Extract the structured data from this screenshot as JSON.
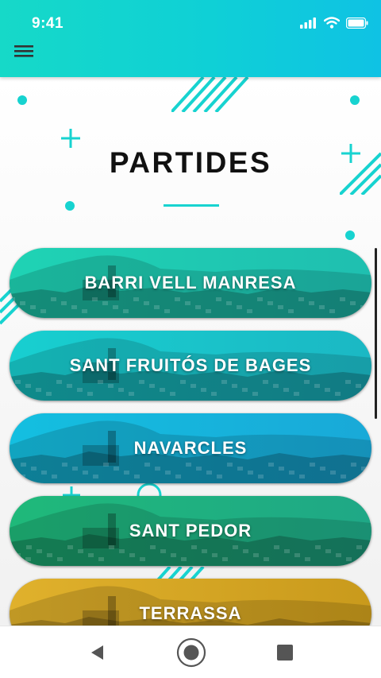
{
  "status_bar": {
    "time": "9:41",
    "icons": [
      "signal-icon",
      "wifi-icon",
      "battery-icon"
    ]
  },
  "toolbar": {
    "menu_icon": "hamburger-menu-icon"
  },
  "page": {
    "title": "PARTIDES"
  },
  "cities": [
    {
      "label": "BARRI VELL MANRESA",
      "color_left": "#1fd3b4",
      "color_right": "#1fbfb0"
    },
    {
      "label": "SANT FRUITÓS DE BAGES",
      "color_left": "#18cfd0",
      "color_right": "#1bb8c4"
    },
    {
      "label": "NAVARCLES",
      "color_left": "#14bfe0",
      "color_right": "#19a9d8"
    },
    {
      "label": "SANT PEDOR",
      "color_left": "#1fb97a",
      "color_right": "#1fa886"
    },
    {
      "label": "TERRASSA",
      "color_left": "#e0b12c",
      "color_right": "#c99a1c"
    }
  ],
  "nav": {
    "back": "back-icon",
    "home": "home-icon",
    "recents": "recents-icon"
  },
  "colors": {
    "accent": "#17d3d0",
    "header_start": "#16d9c8",
    "header_end": "#0fc2e4"
  }
}
